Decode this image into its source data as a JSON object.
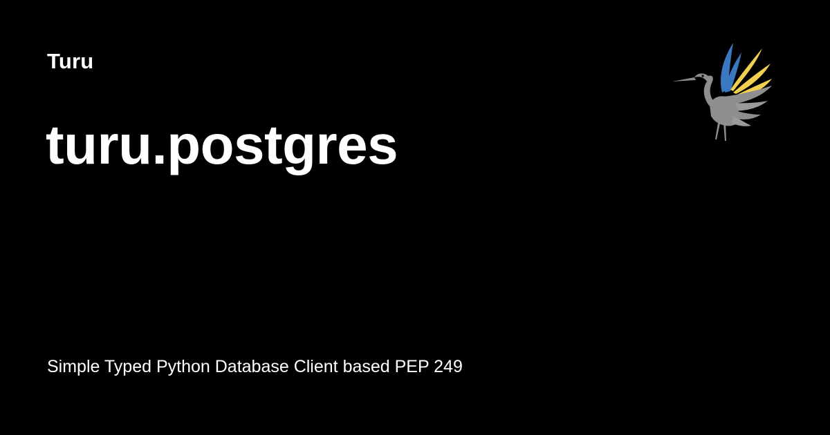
{
  "site": {
    "name": "Turu"
  },
  "page": {
    "title": "turu.postgres",
    "description": "Simple Typed Python Database Client based PEP 249"
  },
  "logo": {
    "icon": "heron-bird-logo",
    "colors": {
      "body": "#8e8e8e",
      "wing_blue": "#3a78c2",
      "wing_yellow": "#f2d04f"
    }
  },
  "colors": {
    "background": "#000000",
    "text": "#ffffff"
  }
}
